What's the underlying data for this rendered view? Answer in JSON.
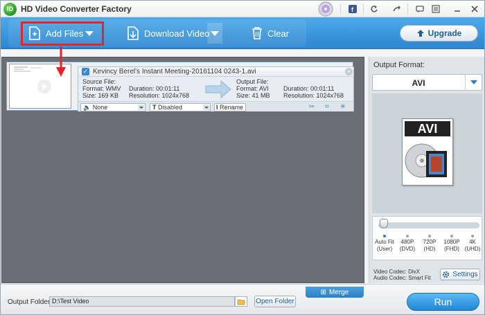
{
  "app": {
    "title": "HD Video Converter Factory",
    "logo_text": "ID"
  },
  "titlebar": {
    "icons": [
      "disc-icon",
      "facebook-icon",
      "refresh-icon",
      "share-icon",
      "feedback-icon",
      "menu-icon",
      "minimize-icon",
      "close-icon"
    ]
  },
  "toolbar": {
    "add_files_label": "Add Files",
    "download_video_label": "Download Video",
    "clear_label": "Clear",
    "upgrade_label": "Upgrade"
  },
  "file": {
    "name": "Kevincy Berel's Instant Meeting-20161104 0243-1.avi",
    "source_title": "Source File:",
    "source_format": "Format: WMV",
    "source_size": "Size: 169 KB",
    "source_duration": "Duration: 00:01:11",
    "source_resolution": "Resolution: 1024x768",
    "output_title": "Output File:",
    "output_format": "Format: AVI",
    "output_size": "Size: 41 MB",
    "output_duration": "Duration: 00:01:11",
    "output_resolution": "Resolution: 1024x768",
    "audio_value": "None",
    "subtitle_value": "Disabled",
    "rename_label": "Rename"
  },
  "output_panel": {
    "label": "Output Format:",
    "format": "AVI",
    "format_icon_text": "AVI",
    "quality_levels": [
      {
        "line1": "Auto Fit",
        "line2": "(User)"
      },
      {
        "line1": "480P",
        "line2": "(DVD)"
      },
      {
        "line1": "720P",
        "line2": "(HD)"
      },
      {
        "line1": "1080P",
        "line2": "(FHD)"
      },
      {
        "line1": "4K",
        "line2": "(UHD)"
      }
    ],
    "quality_selected_index": 0,
    "video_codec": "Video Codec: DivX",
    "audio_codec": "Audio Codec: Smart Fit",
    "settings_label": "Settings"
  },
  "bottom": {
    "merge_label": "Merge",
    "output_folder_label": "Output Folder:",
    "output_folder_value": "D:\\Test Video",
    "open_folder_label": "Open Folder",
    "run_label": "Run"
  },
  "colors": {
    "accent": "#2d86cf",
    "highlight": "#e3242b"
  }
}
